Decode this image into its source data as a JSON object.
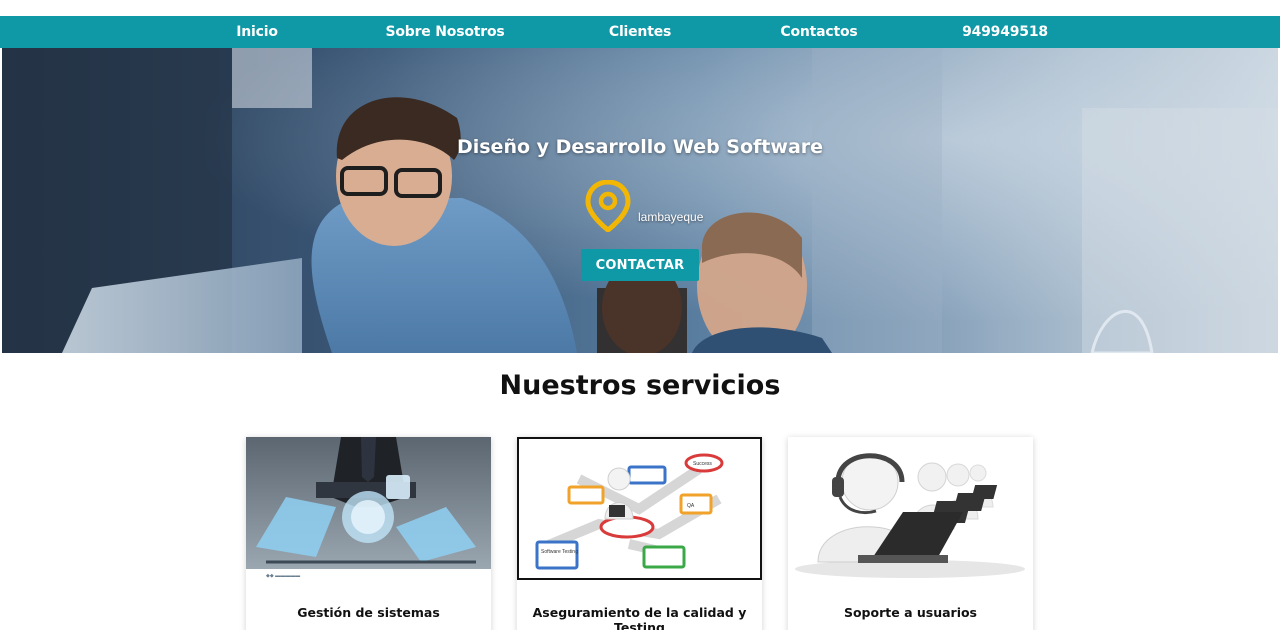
{
  "nav": {
    "items": [
      {
        "label": "Inicio"
      },
      {
        "label": "Sobre Nosotros"
      },
      {
        "label": "Clientes"
      },
      {
        "label": "Contactos"
      },
      {
        "label": "949949518"
      }
    ]
  },
  "hero": {
    "title": "Diseño y Desarrollo Web Software",
    "location": "lambayeque",
    "location_icon": "map-pin-icon",
    "cta_label": "CONTACTAR"
  },
  "services": {
    "title": "Nuestros servicios",
    "cards": [
      {
        "title": "Gestión de sistemas",
        "image": "business-technology-image"
      },
      {
        "title": "Aseguramiento de la calidad y Testing",
        "image": "software-testing-diagram-image",
        "diagram_labels": [
          "Software Testing",
          "QA",
          "Success"
        ]
      },
      {
        "title": "Soporte a usuarios",
        "image": "support-agents-headset-image"
      }
    ]
  },
  "colors": {
    "accent": "#0f98a6",
    "pin": "#f2b705",
    "text": "#111111"
  }
}
